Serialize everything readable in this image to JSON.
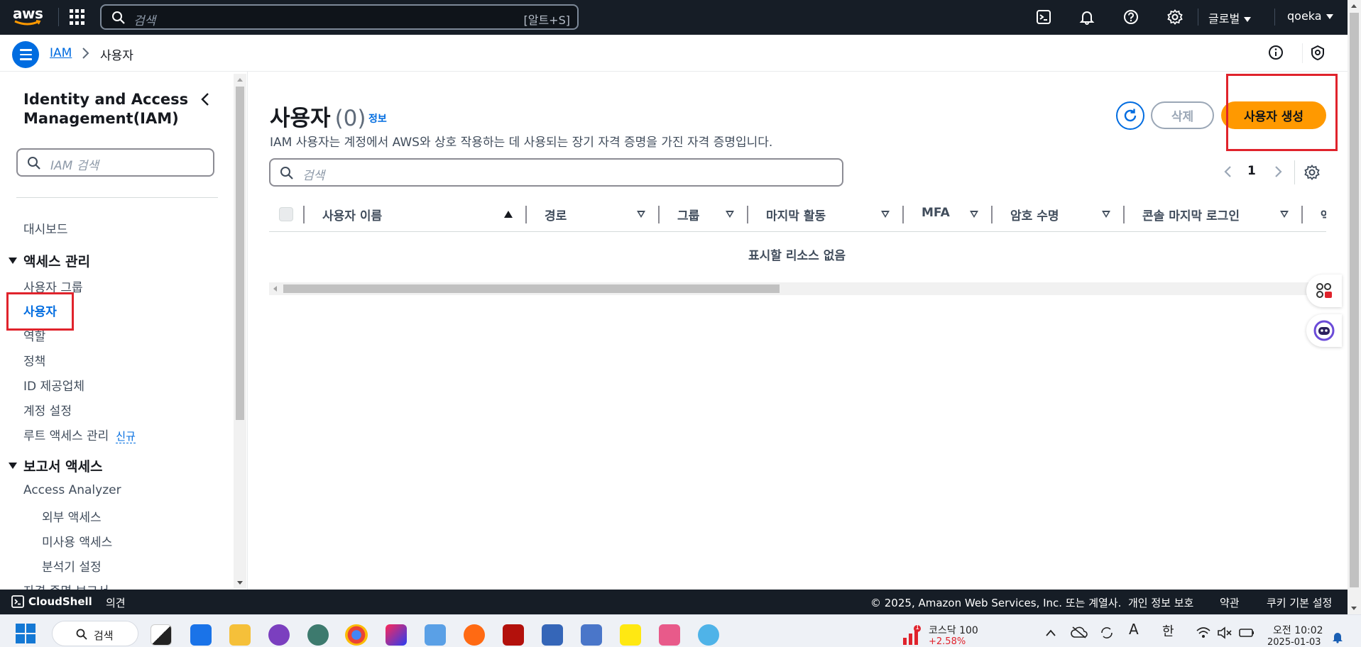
{
  "topnav": {
    "logo_text": "aws",
    "search_placeholder": "검색",
    "search_shortcut": "[알트+S]",
    "region": "글로벌",
    "account": "qoeka"
  },
  "breadcrumb": {
    "service": "IAM",
    "current": "사용자"
  },
  "sidebar": {
    "title": "Identity and Access Management(IAM)",
    "search_placeholder": "IAM 검색",
    "dashboard": "대시보드",
    "section_access": "액세스 관리",
    "items_access": [
      "사용자 그룹",
      "사용자",
      "역할",
      "정책",
      "ID 제공업체",
      "계정 설정",
      "루트 액세스 관리"
    ],
    "new_badge": "신규",
    "section_reports": "보고서 액세스",
    "access_analyzer": "Access Analyzer",
    "analyzer_items": [
      "외부 액세스",
      "미사용 액세스",
      "분석기 설정"
    ],
    "cut_item": "자격 증명 보고서"
  },
  "main": {
    "title": "사용자",
    "count": "(0)",
    "info": "정보",
    "description": "IAM 사용자는 계정에서 AWS와 상호 작용하는 데 사용되는 장기 자격 증명을 가진 자격 증명입니다.",
    "delete_label": "삭제",
    "create_label": "사용자 생성",
    "search_placeholder": "검색",
    "page_number": "1",
    "columns": [
      "사용자 이름",
      "경로",
      "그룹",
      "마지막 활동",
      "MFA",
      "암호 수명",
      "콘솔 마지막 로그인",
      "액"
    ],
    "empty_message": "표시할 리소스 없음"
  },
  "footer": {
    "cloudshell": "CloudShell",
    "feedback": "의견",
    "copyright": "© 2025, Amazon Web Services, Inc. 또는 계열사.",
    "privacy": "개인 정보 보호",
    "terms": "약관",
    "cookies": "쿠키 기본 설정"
  },
  "taskbar": {
    "search_label": "검색",
    "stock_name": "코스닥 100",
    "stock_change": "+2.58%",
    "stock_badge": "1",
    "ime_letter": "A",
    "ime_lang": "한",
    "time": "오전 10:02",
    "date": "2025-01-03"
  },
  "colors": {
    "nav_bg": "#161d26",
    "link": "#006ce0",
    "primary_button": "#ff9900",
    "highlight": "#e0232c"
  }
}
